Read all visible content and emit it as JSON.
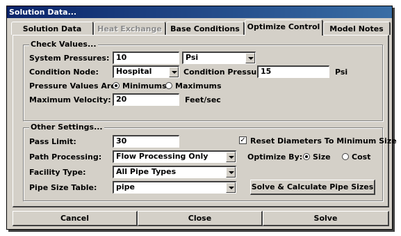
{
  "window": {
    "title": "Solution Data..."
  },
  "tabs": [
    {
      "label": "Solution Data"
    },
    {
      "label": "Heat Exchange"
    },
    {
      "label": "Base Conditions"
    },
    {
      "label": "Optimize Control"
    },
    {
      "label": "Model Notes"
    }
  ],
  "check_values": {
    "legend": "Check Values...",
    "system_pressures": {
      "label": "System Pressures:",
      "value": "10",
      "unit_value": "Psi"
    },
    "condition_node": {
      "label": "Condition Node:",
      "value": "Hospital"
    },
    "condition_pressure": {
      "label": "Condition Pressure:",
      "value": "15",
      "unit": "Psi"
    },
    "pressure_values": {
      "label": "Pressure Values Are:",
      "option_min": "Minimums",
      "option_max": "Maximums",
      "selected": "Minimums"
    },
    "max_velocity": {
      "label": "Maximum Velocity:",
      "value": "20",
      "unit": "Feet/sec"
    }
  },
  "other_settings": {
    "legend": "Other Settings...",
    "pass_limit": {
      "label": "Pass Limit:",
      "value": "30"
    },
    "reset_diameters": {
      "label": "Reset Diameters To Minimum Size",
      "checked": true,
      "mark": "✓"
    },
    "path_processing": {
      "label": "Path Processing:",
      "value": "Flow Processing Only"
    },
    "optimize_by": {
      "label": "Optimize By:",
      "option_size": "Size",
      "option_cost": "Cost",
      "selected": "Size"
    },
    "facility_type": {
      "label": "Facility Type:",
      "value": "All Pipe Types"
    },
    "pipe_size_table": {
      "label": "Pipe Size Table:",
      "value": "pipe"
    },
    "solve_button": "Solve & Calculate Pipe Sizes"
  },
  "footer": {
    "cancel": "Cancel",
    "close": "Close",
    "solve": "Solve"
  }
}
